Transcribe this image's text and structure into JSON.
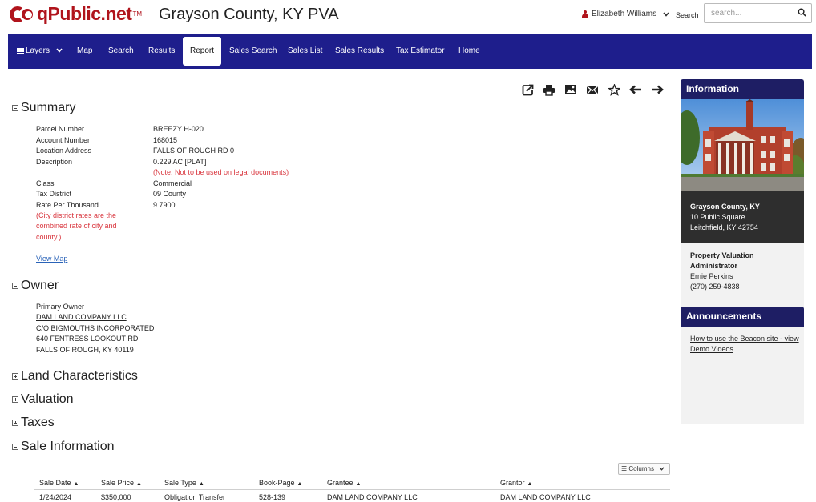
{
  "header": {
    "logo_text": "qPublic.net",
    "logo_tm": "TM",
    "county_title": "Grayson County, KY PVA",
    "user_name": "Elizabeth Williams",
    "search_label": "Search",
    "search_placeholder": "search..."
  },
  "nav": {
    "items": [
      {
        "label": "Layers"
      },
      {
        "label": "Map"
      },
      {
        "label": "Search"
      },
      {
        "label": "Results"
      },
      {
        "label": "Report"
      },
      {
        "label": "Sales Search"
      },
      {
        "label": "Sales List"
      },
      {
        "label": "Sales Results"
      },
      {
        "label": "Tax Estimator"
      },
      {
        "label": "Home"
      }
    ],
    "active": "Report"
  },
  "toolbar": {
    "icons": [
      "share-icon",
      "print-icon",
      "image-icon",
      "email-icon",
      "star-icon",
      "arrow-left-icon",
      "arrow-right-icon"
    ]
  },
  "summary": {
    "title": "Summary",
    "fields": [
      {
        "label": "Parcel Number",
        "value": "BREEZY H-020"
      },
      {
        "label": "Account Number",
        "value": "168015"
      },
      {
        "label": "Location Address",
        "value": "FALLS OF ROUGH RD 0"
      },
      {
        "label": "Description",
        "value": "0.229 AC [PLAT]"
      },
      {
        "label": "Class",
        "value": "Commercial"
      },
      {
        "label": "Tax District",
        "value": "09 County"
      },
      {
        "label": "Rate Per Thousand",
        "value": "9.7900"
      }
    ],
    "description_note": "(Note: Not to be used on legal documents)",
    "rate_note_lines": [
      "(City district rates are the",
      "combined rate of city and",
      "county.)"
    ],
    "view_map": "View Map"
  },
  "owner": {
    "title": "Owner",
    "primary_label": "Primary Owner",
    "name": "DAM LAND COMPANY LLC",
    "lines": [
      "C/O BIGMOUTHS INCORPORATED",
      "640 FENTRESS LOOKOUT RD",
      "FALLS OF ROUGH, KY 40119"
    ]
  },
  "collapsed_sections": [
    "Land Characteristics",
    "Valuation",
    "Taxes"
  ],
  "sale_information": {
    "title": "Sale Information",
    "columns_button": "Columns",
    "headers": [
      "Sale Date",
      "Sale Price",
      "Sale Type",
      "Book-Page",
      "Grantee",
      "Grantor"
    ],
    "rows": [
      [
        "1/24/2024",
        "$350,000",
        "Obligation Transfer",
        "528-139",
        "DAM LAND COMPANY LLC",
        "DAM LAND COMPANY LLC"
      ]
    ]
  },
  "sidebar": {
    "information_title": "Information",
    "address_lines": [
      "Grayson County, KY",
      "10 Public Square",
      "Leitchfield, KY 42754"
    ],
    "pva_lines": [
      "Property Valuation",
      "Administrator"
    ],
    "contact_lines": [
      "Ernie Perkins",
      "(270) 259-4838"
    ],
    "announcements_title": "Announcements",
    "announcement_link_lines": [
      "How to use the Beacon site - view",
      "Demo Videos"
    ]
  },
  "colors": {
    "brand_red": "#b0141c",
    "nav_blue": "#1e1e8c",
    "sidebar_header": "#1e1e64",
    "note_red": "#d9363e",
    "link_blue": "#2a63b8"
  }
}
